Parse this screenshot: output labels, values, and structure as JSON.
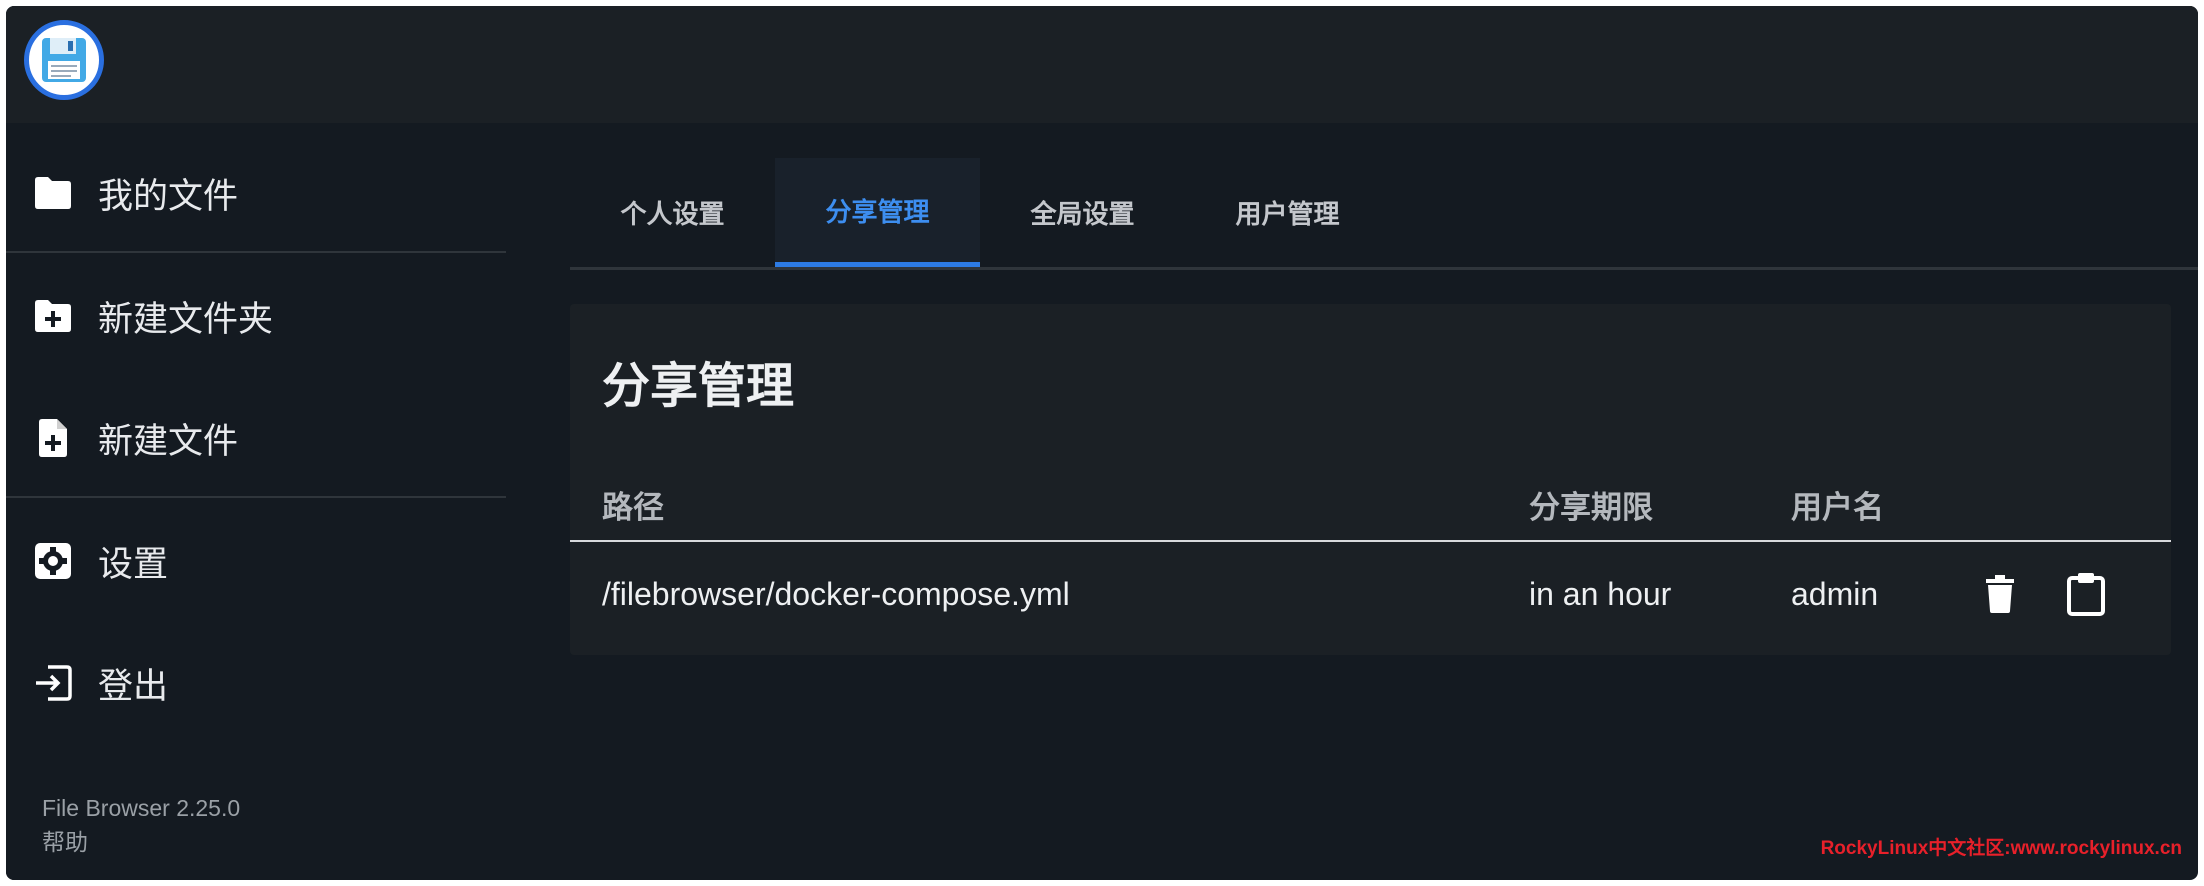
{
  "app": {
    "version": "File Browser 2.25.0",
    "help": "帮助"
  },
  "sidebar": {
    "items": [
      {
        "label": "我的文件",
        "icon": "folder-icon"
      },
      {
        "label": "新建文件夹",
        "icon": "folder-plus-icon"
      },
      {
        "label": "新建文件",
        "icon": "file-plus-icon"
      },
      {
        "label": "设置",
        "icon": "gear-icon"
      },
      {
        "label": "登出",
        "icon": "logout-icon"
      }
    ]
  },
  "tabs": [
    {
      "label": "个人设置",
      "active": false
    },
    {
      "label": "分享管理",
      "active": true
    },
    {
      "label": "全局设置",
      "active": false
    },
    {
      "label": "用户管理",
      "active": false
    }
  ],
  "shares": {
    "title": "分享管理",
    "columns": [
      "路径",
      "分享期限",
      "用户名"
    ],
    "rows": [
      {
        "path": "/filebrowser/docker-compose.yml",
        "expires": "in an hour",
        "user": "admin"
      }
    ]
  },
  "watermark": "RockyLinux中文社区:www.rockylinux.cn",
  "colors": {
    "accent": "#2d7be4",
    "background": "#141a21",
    "watermark": "#e8202a"
  }
}
